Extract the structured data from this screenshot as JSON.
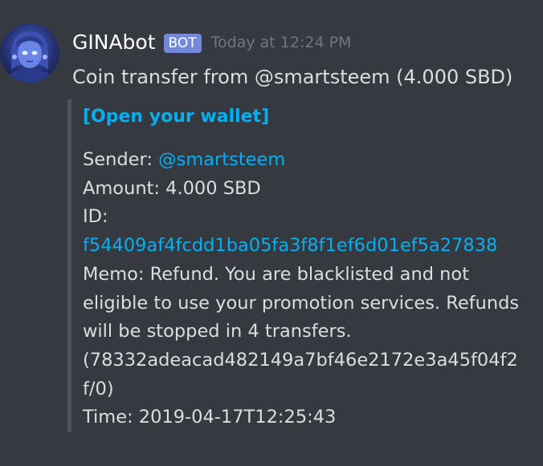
{
  "message": {
    "username": "GINAbot",
    "bot_tag": "BOT",
    "timestamp": "Today at 12:24 PM",
    "content": "Coin transfer from @smartsteem (4.000 SBD)",
    "avatar_icon": "robot-avatar-icon"
  },
  "embed": {
    "title": "[Open your wallet]",
    "sender_label": "Sender: ",
    "sender_value": "@smartsteem",
    "amount": "Amount: 4.000 SBD",
    "id_label": "ID:",
    "id_value": "f54409af4fcdd1ba05fa3f8f1ef6d01ef5a27838",
    "memo_line1": "Memo: Refund. You are blacklisted and not",
    "memo_line2": "eligible to use your promotion services. Refunds",
    "memo_line3": "will be stopped in 4 transfers.",
    "memo_line4": "(78332adeacad482149a7bf46e2172e3a45f04f2",
    "memo_line5": "f/0)",
    "time": "Time: 2019-04-17T12:25:43"
  },
  "colors": {
    "background": "#36393f",
    "link": "#00b0f4",
    "bot_tag": "#7289da",
    "embed_border": "#4f545c",
    "text": "#dcddde",
    "muted": "#72767d"
  }
}
